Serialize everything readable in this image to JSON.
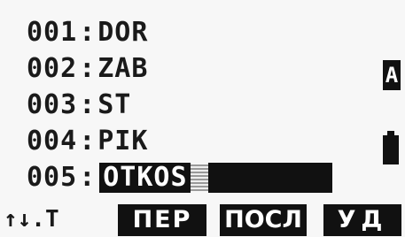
{
  "codes": [
    {
      "num": "001",
      "value": "DOR"
    },
    {
      "num": "002",
      "value": "ZAB"
    },
    {
      "num": "003",
      "value": "ST"
    },
    {
      "num": "004",
      "value": "PIK"
    },
    {
      "num": "005",
      "value": "OTKOS"
    }
  ],
  "separator": ":",
  "editing_index": 4,
  "mode_indicator": "A",
  "battery": {
    "icon": "battery-icon",
    "level": 1.0
  },
  "softkeys": {
    "nav_label": "↑↓.T",
    "key1": "ПЕР",
    "key2": "ПОСЛ",
    "key3": "УД"
  },
  "colors": {
    "display_bg": "#f7f7f7",
    "ink": "#111111",
    "inverse_text": "#ffffff"
  }
}
